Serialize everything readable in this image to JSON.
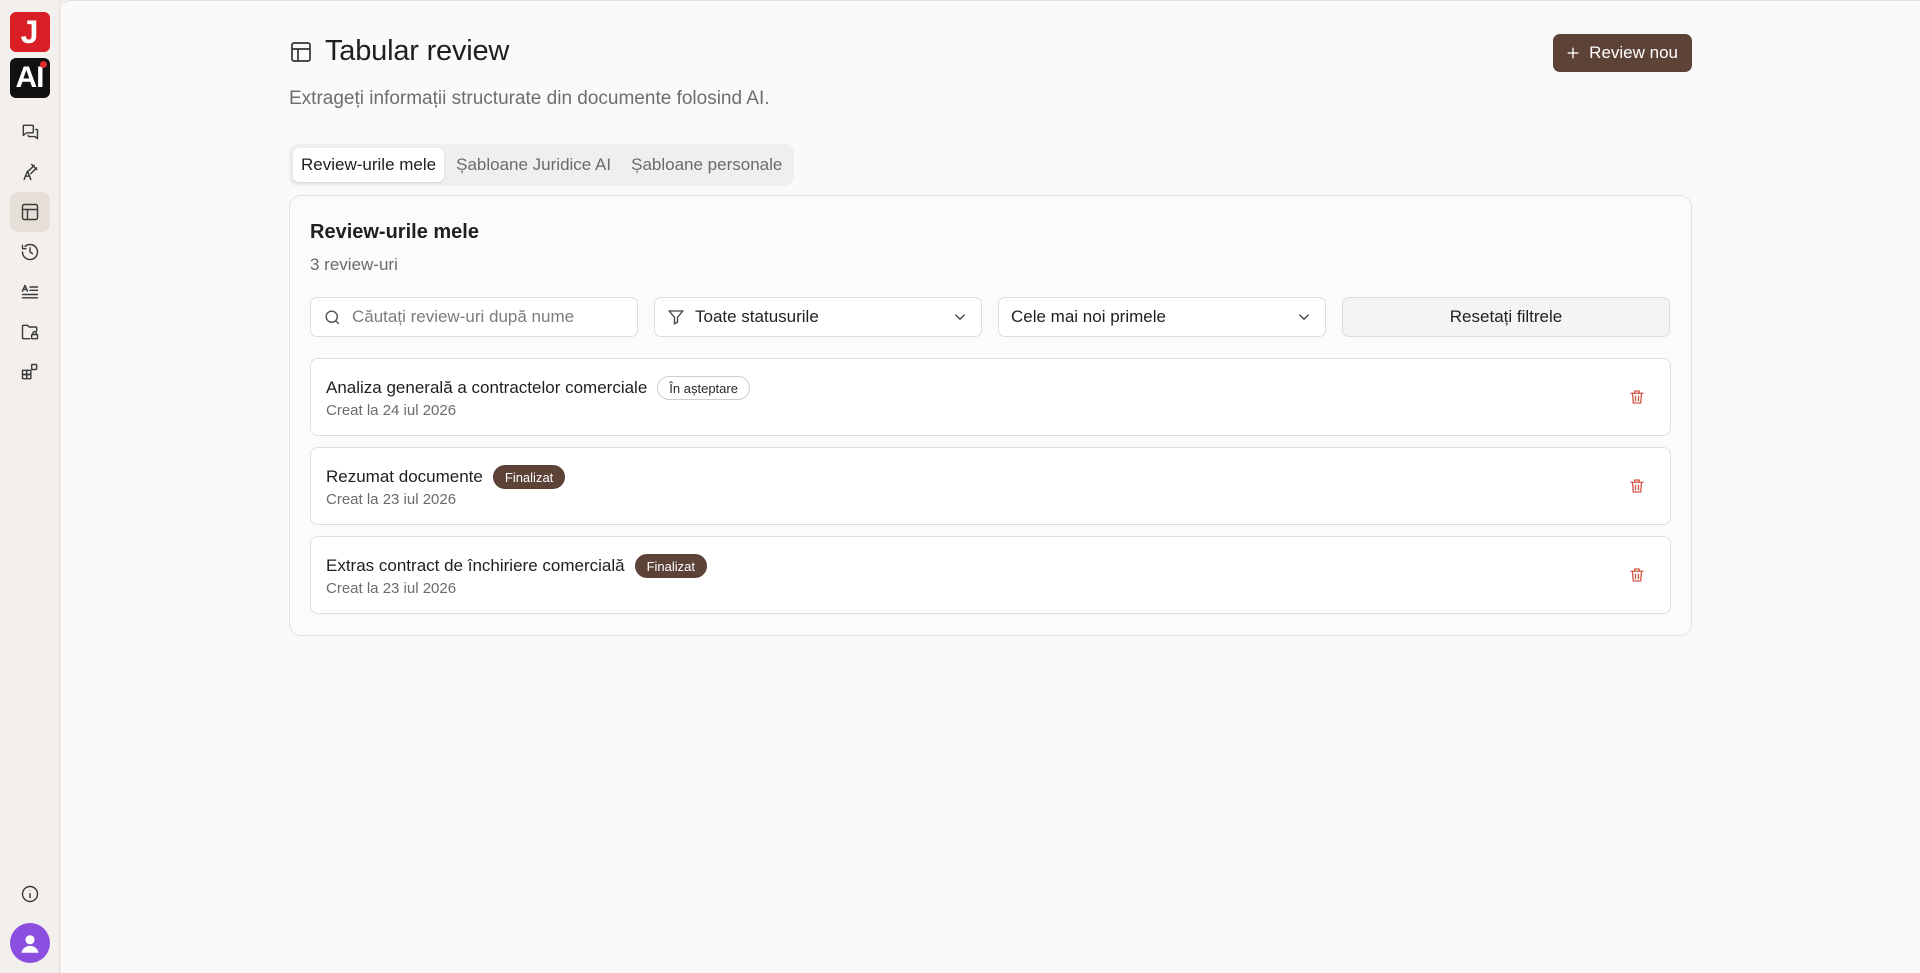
{
  "brand": {
    "logo_top": "J",
    "logo_bottom": "AI"
  },
  "sidebar": {
    "items": [
      {
        "icon": "chat-icon",
        "active": false
      },
      {
        "icon": "drafting-icon",
        "active": false
      },
      {
        "icon": "table-icon",
        "active": true
      },
      {
        "icon": "history-icon",
        "active": false
      },
      {
        "icon": "text-list-icon",
        "active": false
      },
      {
        "icon": "folder-lock-icon",
        "active": false
      },
      {
        "icon": "apps-icon",
        "active": false
      }
    ]
  },
  "header": {
    "title": "Tabular review",
    "subtitle": "Extrageți informații structurate din documente folosind AI.",
    "new_button_label": "Review nou"
  },
  "tabs": [
    {
      "label": "Review-urile mele",
      "active": true
    },
    {
      "label": "Șabloane Juridice AI",
      "active": false
    },
    {
      "label": "Șabloane personale",
      "active": false
    }
  ],
  "card": {
    "title": "Review-urile mele",
    "count": "3 review-uri"
  },
  "filters": {
    "search_placeholder": "Căutați review-uri după nume",
    "search_value": "",
    "status_selected": "Toate statusurile",
    "sort_selected": "Cele mai noi primele",
    "reset_label": "Resetați filtrele"
  },
  "reviews": [
    {
      "name": "Analiza generală a contractelor comerciale",
      "status": "În așteptare",
      "status_type": "pending",
      "date": "Creat la 24 iul 2026"
    },
    {
      "name": "Rezumat documente",
      "status": "Finalizat",
      "status_type": "done",
      "date": "Creat la 23 iul 2026"
    },
    {
      "name": "Extras contract de închiriere comercială",
      "status": "Finalizat",
      "status_type": "done",
      "date": "Creat la 23 iul 2026"
    }
  ],
  "colors": {
    "accent": "#5c4237",
    "danger": "#d4594a",
    "avatar": "#8b4fe0",
    "logo_red": "#d81f26"
  }
}
